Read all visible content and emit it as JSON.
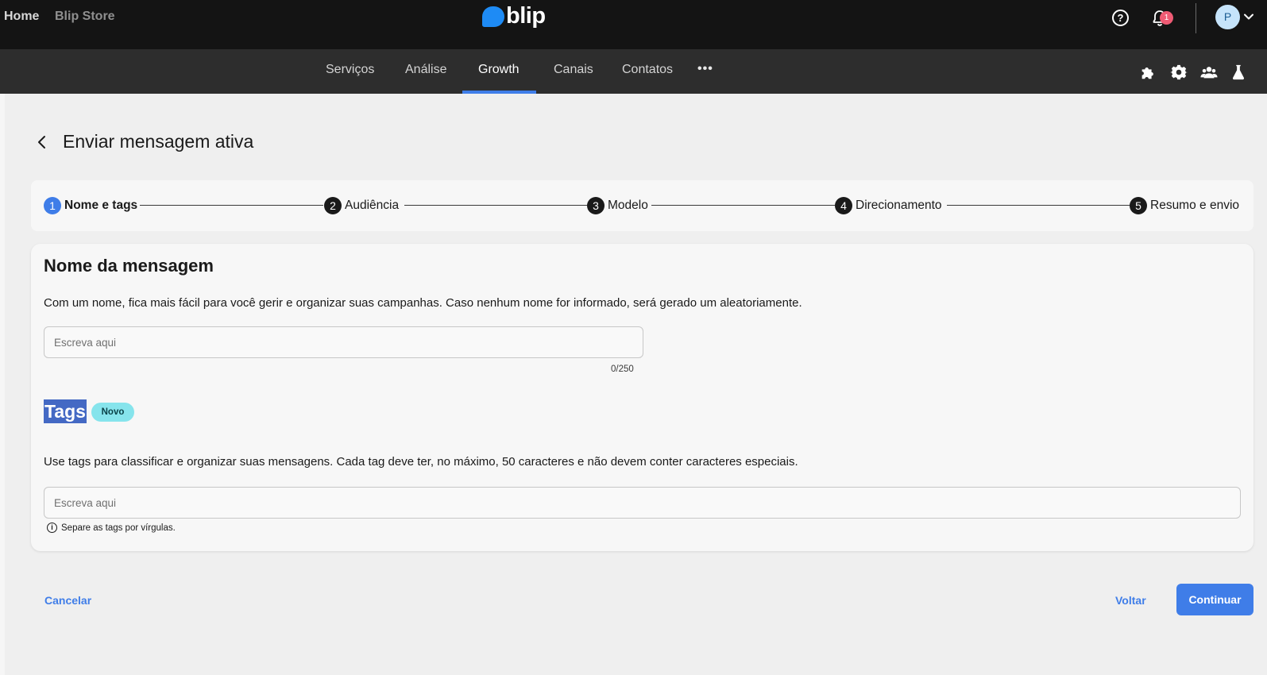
{
  "topbar": {
    "home_label": "Home",
    "store_label": "Blip Store",
    "logo_text": "blip",
    "help_glyph": "?",
    "notification_count": "1",
    "avatar_initial": "P"
  },
  "nav": {
    "items": [
      {
        "label": "Serviços",
        "active": false
      },
      {
        "label": "Análise",
        "active": false
      },
      {
        "label": "Growth",
        "active": true
      },
      {
        "label": "Canais",
        "active": false
      },
      {
        "label": "Contatos",
        "active": false
      }
    ],
    "more_label": "•••",
    "right_icons": [
      "puzzle-icon",
      "gear-icon",
      "users-icon",
      "flask-icon"
    ]
  },
  "page": {
    "title": "Enviar mensagem ativa"
  },
  "stepper": {
    "current_step": 1,
    "steps": [
      {
        "number": "1",
        "label": "Nome e tags"
      },
      {
        "number": "2",
        "label": "Audiência"
      },
      {
        "number": "3",
        "label": "Modelo"
      },
      {
        "number": "4",
        "label": "Direcionamento"
      },
      {
        "number": "5",
        "label": "Resumo e envio"
      }
    ]
  },
  "form": {
    "name_title": "Nome da mensagem",
    "name_description": "Com um nome, fica mais fácil para você gerir e organizar suas campanhas. Caso nenhum nome for informado, será gerado um aleatoriamente.",
    "name_placeholder": "Escreva aqui",
    "name_value": "",
    "name_counter": "0/250",
    "tags_title": "Tags",
    "tags_badge": "Novo",
    "tags_description": "Use tags para classificar e organizar suas mensagens. Cada tag deve ter, no máximo, 50 caracteres e não devem conter caracteres especiais.",
    "tags_placeholder": "Escreva aqui",
    "tags_value": "",
    "tags_hint": "Separe as tags por vírgulas.",
    "info_glyph": "i"
  },
  "footer": {
    "cancel_label": "Cancelar",
    "back_label": "Voltar",
    "continue_label": "Continuar"
  },
  "colors": {
    "accent": "#3f7de8",
    "topbar_bg": "#141414",
    "navbar_bg": "#2d2d2d",
    "badge": "#ef5b74",
    "new_badge": "#86e4ec"
  }
}
